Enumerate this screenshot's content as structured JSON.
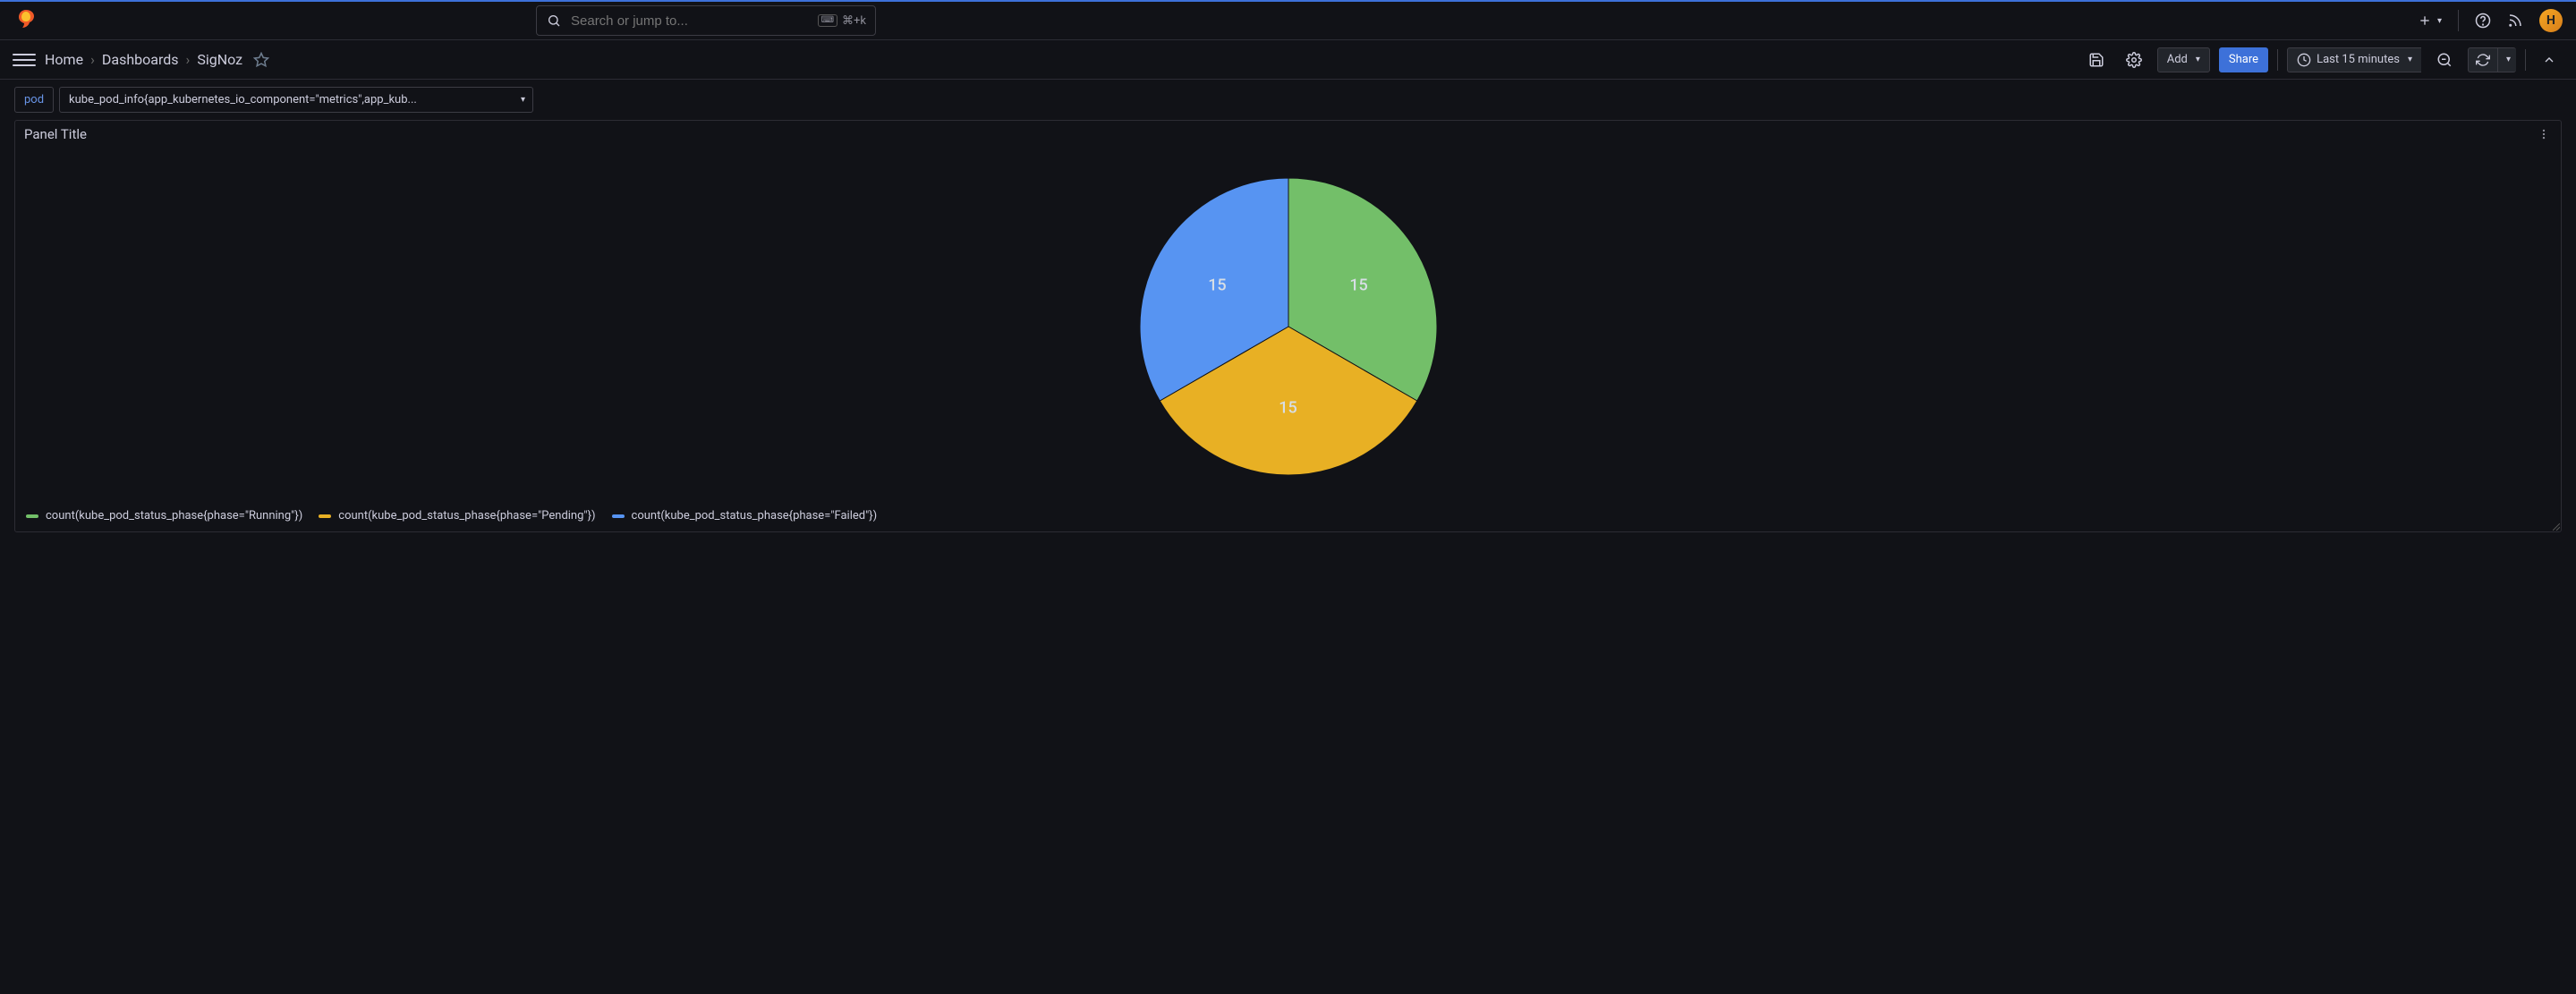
{
  "top_nav": {
    "search_placeholder": "Search or jump to...",
    "search_shortcut": "⌘+k"
  },
  "toolbar": {
    "breadcrumb": {
      "home": "Home",
      "dashboards": "Dashboards",
      "current": "SigNoz"
    },
    "add_label": "Add",
    "share_label": "Share",
    "time_range": "Last 15 minutes"
  },
  "variables": {
    "label": "pod",
    "value": "kube_pod_info{app_kubernetes_io_component=\"metrics\",app_kub..."
  },
  "panel": {
    "title": "Panel Title"
  },
  "legend": {
    "running": "count(kube_pod_status_phase{phase=\"Running\"})",
    "pending": "count(kube_pod_status_phase{phase=\"Pending\"})",
    "failed": "count(kube_pod_status_phase{phase=\"Failed\"})"
  },
  "colors": {
    "running": "#73bf69",
    "pending": "#e8b024",
    "failed": "#5794f2"
  },
  "chart_data": {
    "type": "pie",
    "title": "Panel Title",
    "series": [
      {
        "name": "count(kube_pod_status_phase{phase=\"Running\"})",
        "value": 15,
        "color": "#73bf69"
      },
      {
        "name": "count(kube_pod_status_phase{phase=\"Pending\"})",
        "value": 15,
        "color": "#e8b024"
      },
      {
        "name": "count(kube_pod_status_phase{phase=\"Failed\"})",
        "value": 15,
        "color": "#5794f2"
      }
    ]
  }
}
